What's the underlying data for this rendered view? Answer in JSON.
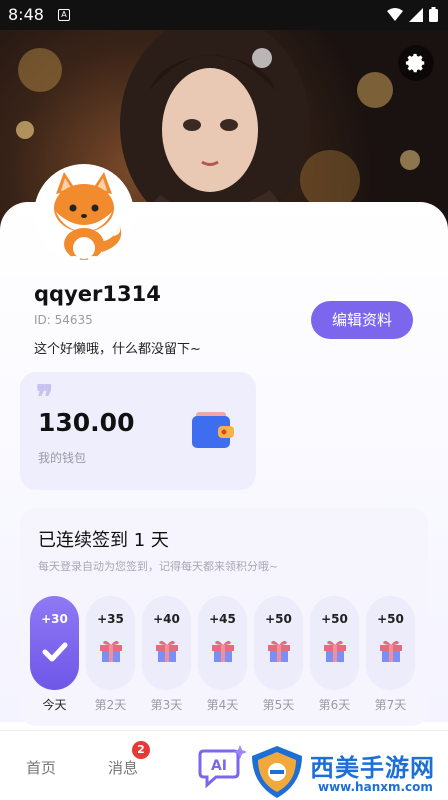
{
  "status_bar": {
    "time": "8:48",
    "notification_glyph": "A"
  },
  "profile": {
    "username": "qqyer1314",
    "id": "ID: 54635",
    "bio": "这个好懒哦，什么都没留下~",
    "edit_button": "编辑资料"
  },
  "wallet": {
    "quote_mark": "❞",
    "amount": "130.00",
    "label": "我的钱包"
  },
  "checkin": {
    "title": "已连续签到 1 天",
    "subtitle": "每天登录自动为您签到，记得每天都来领积分哦~",
    "days": [
      {
        "points": "+30",
        "label": "今天",
        "active": true,
        "icon": "check-icon"
      },
      {
        "points": "+35",
        "label": "第2天",
        "active": false,
        "icon": "gift-icon"
      },
      {
        "points": "+40",
        "label": "第3天",
        "active": false,
        "icon": "gift-icon"
      },
      {
        "points": "+45",
        "label": "第4天",
        "active": false,
        "icon": "gift-icon"
      },
      {
        "points": "+50",
        "label": "第5天",
        "active": false,
        "icon": "gift-icon"
      },
      {
        "points": "+50",
        "label": "第6天",
        "active": false,
        "icon": "gift-icon"
      },
      {
        "points": "+50",
        "label": "第7天",
        "active": false,
        "icon": "gift-icon"
      }
    ]
  },
  "tabbar": {
    "home": "首页",
    "messages": "消息",
    "messages_badge": "2",
    "ai_label": "AI"
  },
  "watermark": {
    "title": "西美手游网",
    "url": "www.hanxm.com"
  },
  "colors": {
    "accent": "#7d66ee",
    "badge": "#e53935",
    "watermark": "#1d6fd6"
  }
}
